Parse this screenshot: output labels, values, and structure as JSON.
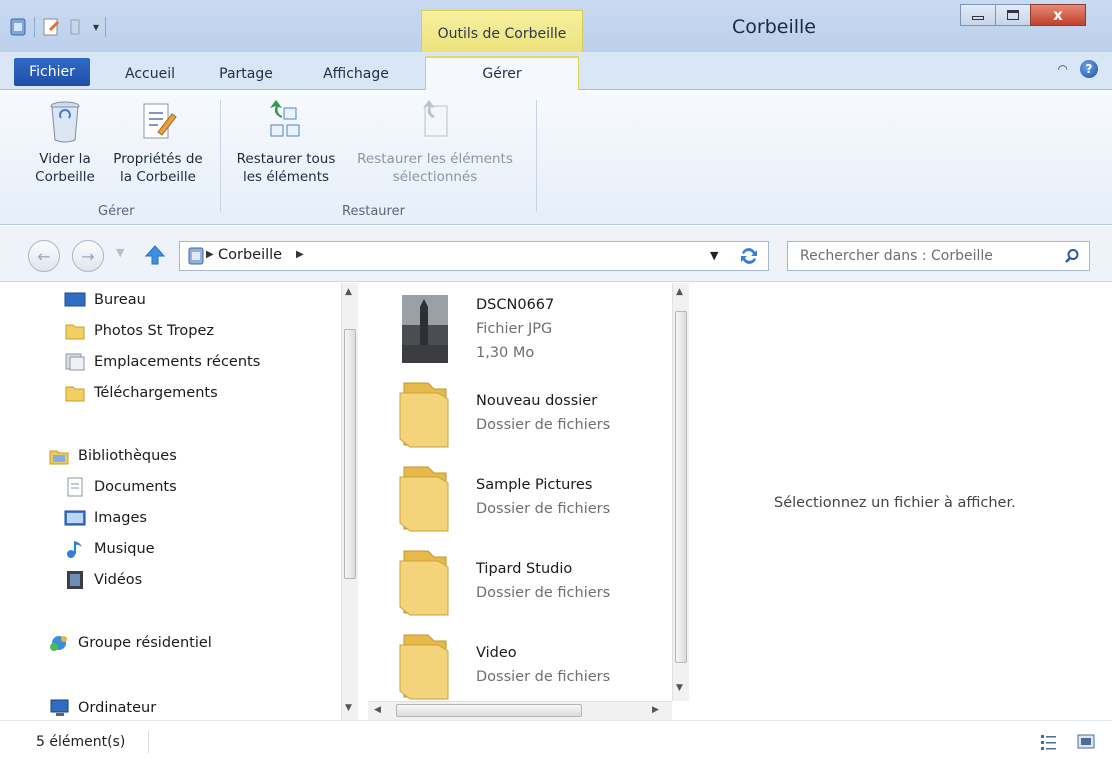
{
  "window": {
    "title": "Corbeille",
    "context_tab": "Outils de Corbeille",
    "close_glyph": "x"
  },
  "ribbon_tabs": {
    "fichier": "Fichier",
    "accueil": "Accueil",
    "partage": "Partage",
    "affichage": "Affichage",
    "gerer": "Gérer",
    "help_glyph": "?"
  },
  "ribbon": {
    "empty_bin": {
      "line1": "Vider la",
      "line2": "Corbeille"
    },
    "bin_properties": {
      "line1": "Propriétés de",
      "line2": "la Corbeille"
    },
    "group_manage": "Gérer",
    "restore_all": {
      "line1": "Restaurer tous",
      "line2": "les éléments"
    },
    "restore_selected": {
      "line1": "Restaurer les éléments",
      "line2": "sélectionnés"
    },
    "group_restore": "Restaurer"
  },
  "address": {
    "path": "Corbeille",
    "search_placeholder": "Rechercher dans : Corbeille"
  },
  "nav": {
    "favorites": [
      "Bureau",
      "Photos St Tropez",
      "Emplacements récents",
      "Téléchargements"
    ],
    "libraries": "Bibliothèques",
    "library_items": [
      "Documents",
      "Images",
      "Musique",
      "Vidéos"
    ],
    "homegroup": "Groupe résidentiel",
    "computer": "Ordinateur"
  },
  "files": [
    {
      "name": "DSCN0667",
      "type": "Fichier JPG",
      "size": "1,30 Mo",
      "icon": "photo-thumbnail"
    },
    {
      "name": "Nouveau dossier",
      "type": "Dossier de fichiers",
      "icon": "folder-icon"
    },
    {
      "name": "Sample Pictures",
      "type": "Dossier de fichiers",
      "icon": "folder-icon"
    },
    {
      "name": "Tipard Studio",
      "type": "Dossier de fichiers",
      "icon": "folder-icon"
    },
    {
      "name": "Video",
      "type": "Dossier de fichiers",
      "icon": "folder-icon"
    }
  ],
  "preview": {
    "message": "Sélectionnez un fichier à afficher."
  },
  "status": {
    "count": "5 élément(s)"
  },
  "colors": {
    "accent": "#1f4fa8",
    "context_tab": "#ece27b",
    "folder": "#f2cf63"
  }
}
